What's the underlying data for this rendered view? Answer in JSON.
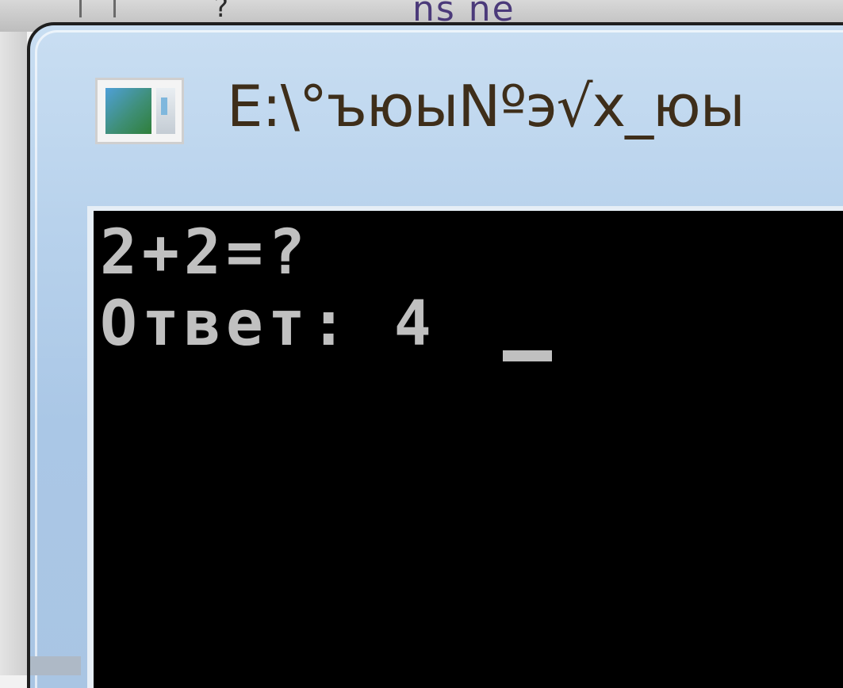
{
  "background_window": {
    "title_fragment": "ns ne",
    "mark": "?"
  },
  "window": {
    "title": "E:\\°ъюыNºэ√х_юы",
    "icon": "console-window-icon"
  },
  "console": {
    "lines": [
      "2+2=?",
      "Ответ: 4"
    ],
    "cursor": "_"
  },
  "colors": {
    "console_background": "#000000",
    "console_text": "#c0c0c0",
    "titlebar": "#b8d2ec"
  }
}
